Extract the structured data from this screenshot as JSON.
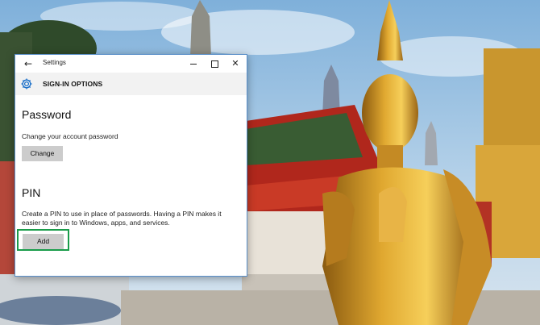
{
  "window": {
    "title": "Settings",
    "back_icon": "back-arrow-icon",
    "controls": [
      "minimize-icon",
      "maximize-icon",
      "close-icon"
    ]
  },
  "header": {
    "icon": "gear-icon",
    "title": "SIGN-IN OPTIONS"
  },
  "password": {
    "title": "Password",
    "description": "Change your account password",
    "button_label": "Change"
  },
  "pin": {
    "title": "PIN",
    "description": "Create a PIN to use in place of passwords. Having a PIN makes it easier to sign in to Windows, apps, and services.",
    "button_label": "Add"
  },
  "colors": {
    "highlight": "#1a9c4a",
    "button": "#cccccc",
    "header_bg": "#f2f2f2"
  }
}
